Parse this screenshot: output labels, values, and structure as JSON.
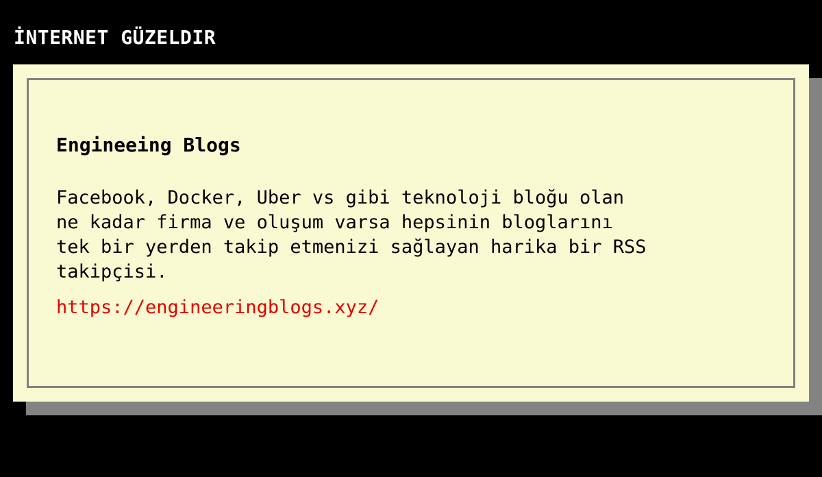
{
  "header": {
    "title": "İNTERNET GÜZELDIR"
  },
  "card": {
    "title": "Engineeing Blogs",
    "description": "Facebook, Docker, Uber vs gibi teknoloji bloğu olan\nne kadar firma ve oluşum varsa hepsinin bloglarını\ntek bir yerden takip etmenizi sağlayan harika bir RSS\ntakipçisi.",
    "link_text": "https://engineeringblogs.xyz/"
  },
  "colors": {
    "background": "#000000",
    "card_background": "#fafad2",
    "card_border": "#808080",
    "shadow": "#838383",
    "link": "#e60000",
    "title_text": "#ffffff"
  }
}
